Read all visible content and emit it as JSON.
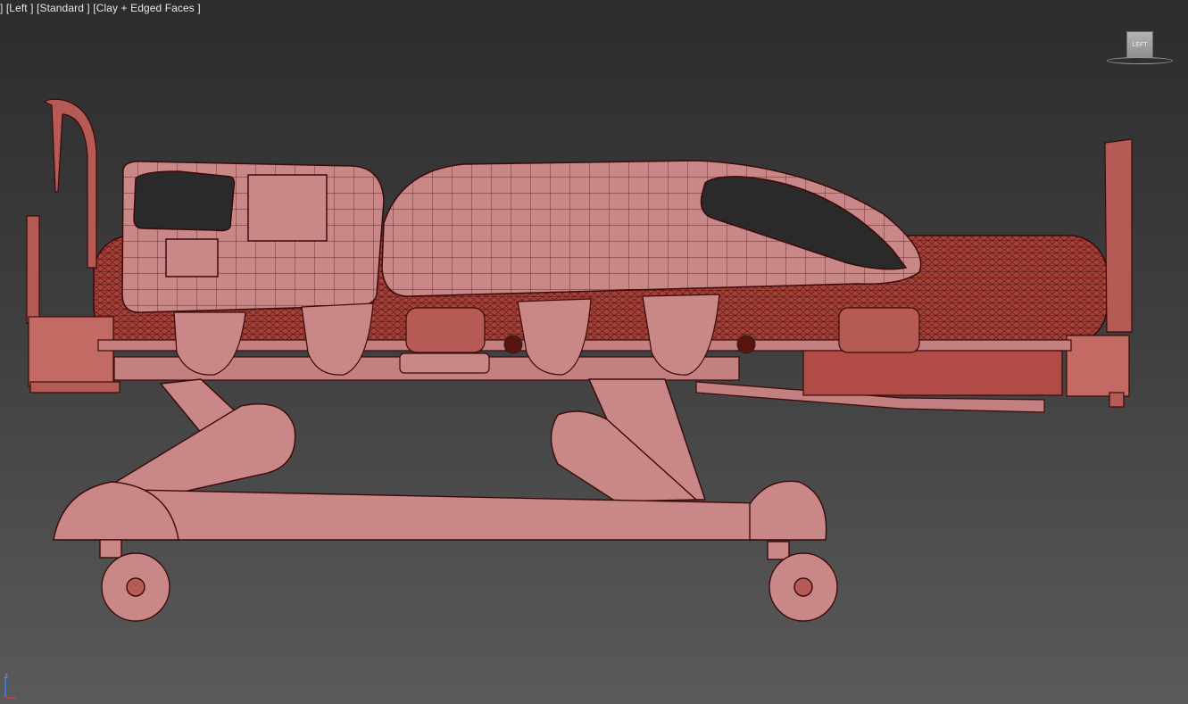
{
  "viewport": {
    "label_pov": "[Left ]",
    "label_shading_mode": "[Standard ]",
    "label_display": "[Clay + Edged Faces ]",
    "label_prefix": "]"
  },
  "viewcube": {
    "face_label": "LEFT"
  },
  "axis": {
    "z_label": "z"
  },
  "colors": {
    "mesh_fill": "#c98787",
    "mesh_fill_dark": "#9e4a45",
    "wire": "#3a0a08",
    "mattress": "#a5423a"
  }
}
